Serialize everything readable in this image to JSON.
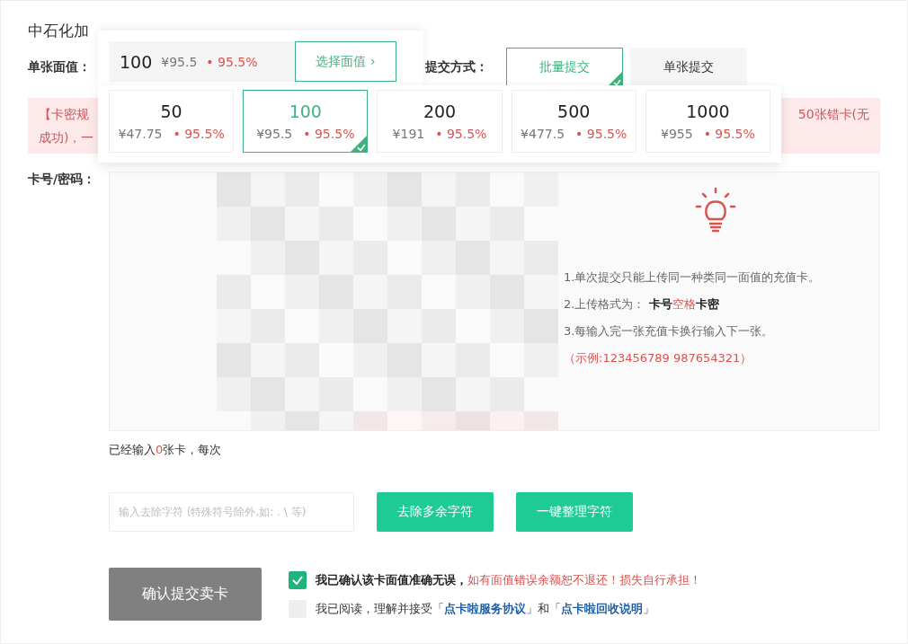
{
  "title": "中石化加",
  "face_value": {
    "label": "单张面值：",
    "current": {
      "amount": "100",
      "price": "¥95.5",
      "rate": "• 95.5%"
    },
    "choose_button": "选择面值",
    "choose_icon": "›",
    "options": [
      {
        "amount": "50",
        "price": "¥47.75",
        "rate": "• 95.5%",
        "selected": false
      },
      {
        "amount": "100",
        "price": "¥95.5",
        "rate": "• 95.5%",
        "selected": true
      },
      {
        "amount": "200",
        "price": "¥191",
        "rate": "• 95.5%",
        "selected": false
      },
      {
        "amount": "500",
        "price": "¥477.5",
        "rate": "• 95.5%",
        "selected": false
      },
      {
        "amount": "1000",
        "price": "¥955",
        "rate": "• 95.5%",
        "selected": false
      }
    ]
  },
  "submit_mode": {
    "label": "提交方式：",
    "options": [
      {
        "label": "批量提交",
        "selected": true
      },
      {
        "label": "单张提交",
        "selected": false
      }
    ]
  },
  "warning": {
    "left_lines": [
      "【卡密规",
      "成功)，一"
    ],
    "right_text": "50张错卡(无"
  },
  "card_input": {
    "label": "卡号/密码：",
    "tips": [
      [
        {
          "text": "1.单次提交只能上传同一种类同一面值的充值卡。",
          "kind": "plain"
        }
      ],
      [
        {
          "text": "2.上传格式为： ",
          "kind": "plain"
        },
        {
          "text": "卡号",
          "kind": "bold"
        },
        {
          "text": "空格",
          "kind": "red"
        },
        {
          "text": "卡密",
          "kind": "bold"
        }
      ],
      [
        {
          "text": "3.每输入完一张充值卡换行输入下一张。",
          "kind": "plain"
        }
      ],
      [
        {
          "text": "（示例:123456789 987654321）",
          "kind": "red"
        }
      ]
    ]
  },
  "count_line": [
    {
      "text": "已经输入",
      "kind": "plain"
    },
    {
      "text": "0",
      "kind": "red"
    },
    {
      "text": "张卡，每次",
      "kind": "plain"
    }
  ],
  "strip": {
    "placeholder": "输入去除字符 (特殊符号除外,如: . \\ 等)",
    "buttons": [
      "去除多余字符",
      "一键整理字符"
    ]
  },
  "confirm_button": "确认提交卖卡",
  "agreements": [
    {
      "checked": true,
      "parts": [
        {
          "text": "我已确认该卡面值准确无误，",
          "kind": "bold"
        },
        {
          "text": "如有面值错误余额恕不退还！损失自行承担！",
          "kind": "red"
        }
      ]
    },
    {
      "checked": false,
      "parts": [
        {
          "text": "我已阅读，理解并接受「",
          "kind": "plain"
        },
        {
          "text": "点卡啦服务协议",
          "kind": "link"
        },
        {
          "text": "」和「",
          "kind": "plain"
        },
        {
          "text": "点卡啦回收说明",
          "kind": "link"
        },
        {
          "text": "」",
          "kind": "plain"
        }
      ]
    }
  ]
}
